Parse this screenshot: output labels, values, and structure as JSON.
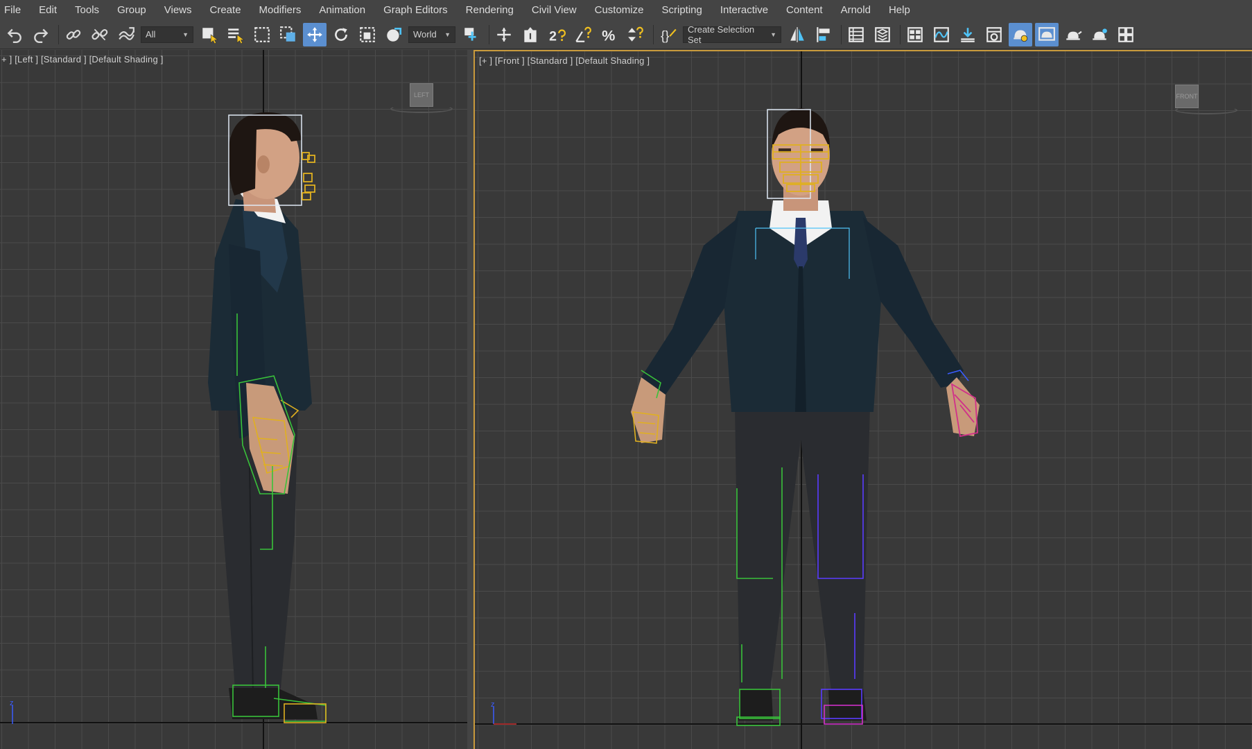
{
  "menu": [
    "File",
    "Edit",
    "Tools",
    "Group",
    "Views",
    "Create",
    "Modifiers",
    "Animation",
    "Graph Editors",
    "Rendering",
    "Civil View",
    "Customize",
    "Scripting",
    "Interactive",
    "Content",
    "Arnold",
    "Help"
  ],
  "toolbar": {
    "selection_filter": "All",
    "reference_coord": "World",
    "named_selection": "Create Selection Set"
  },
  "viewports": {
    "left": {
      "label": "+ ] [Left ] [Standard ] [Default Shading ]",
      "viewcube": "LEFT"
    },
    "front": {
      "label": "[+ ] [Front ] [Standard ] [Default Shading ]",
      "viewcube": "FRONT"
    }
  },
  "colors": {
    "accent_active": "#5b8fd0",
    "viewport_border_active": "#c99a3c",
    "suit": "#1b2b36",
    "pants": "#2a2c30"
  }
}
